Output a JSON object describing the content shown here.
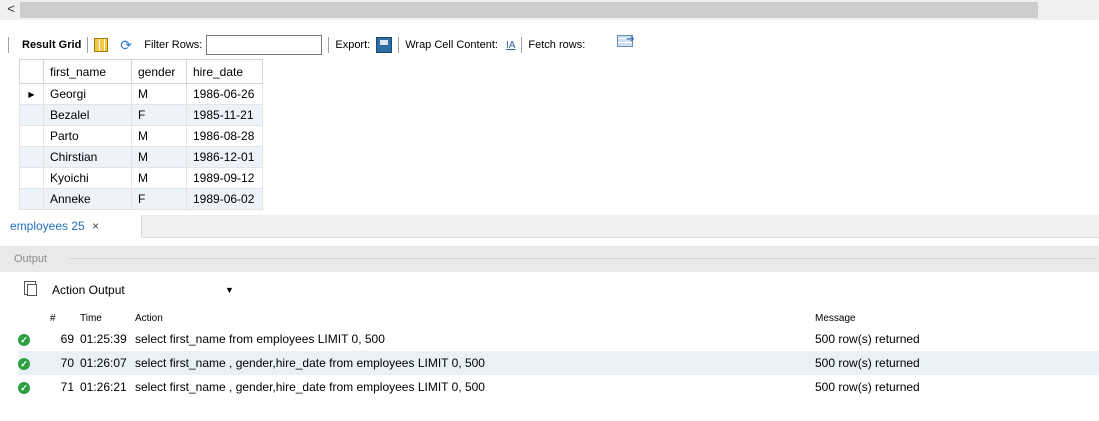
{
  "scroll": {
    "left_arrow": "<"
  },
  "toolbar": {
    "result_grid": "Result Grid",
    "filter_rows": "Filter Rows:",
    "filter_value": "",
    "export": "Export:",
    "wrap_cell": "Wrap Cell Content:",
    "wrap_icon": "IA",
    "fetch_rows": "Fetch rows:"
  },
  "grid": {
    "columns": [
      "first_name",
      "gender",
      "hire_date"
    ],
    "rows": [
      {
        "first_name": "Georgi",
        "gender": "M",
        "hire_date": "1986-06-26"
      },
      {
        "first_name": "Bezalel",
        "gender": "F",
        "hire_date": "1985-11-21"
      },
      {
        "first_name": "Parto",
        "gender": "M",
        "hire_date": "1986-08-28"
      },
      {
        "first_name": "Chirstian",
        "gender": "M",
        "hire_date": "1986-12-01"
      },
      {
        "first_name": "Kyoichi",
        "gender": "M",
        "hire_date": "1989-09-12"
      },
      {
        "first_name": "Anneke",
        "gender": "F",
        "hire_date": "1989-06-02"
      }
    ],
    "current_row_marker": "▶"
  },
  "tab": {
    "label": "employees 25",
    "close": "×"
  },
  "output": {
    "title": "Output",
    "select_value": "Action Output",
    "columns": {
      "num": "#",
      "time": "Time",
      "action": "Action",
      "message": "Message"
    },
    "rows": [
      {
        "num": "69",
        "time": "01:25:39",
        "action": "select first_name from employees LIMIT 0, 500",
        "message": "500 row(s) returned"
      },
      {
        "num": "70",
        "time": "01:26:07",
        "action": "select first_name , gender,hire_date from employees LIMIT 0, 500",
        "message": "500 row(s) returned"
      },
      {
        "num": "71",
        "time": "01:26:21",
        "action": "select first_name , gender,hire_date from employees LIMIT 0, 500",
        "message": "500 row(s) returned"
      }
    ]
  },
  "colors": {
    "success": "#2da041",
    "tab_text": "#1e6fbd",
    "selected_row": "#e9f0f8"
  },
  "icons": [
    "grid-icon",
    "filter-icon",
    "export-icon",
    "wrap-icon",
    "fetch-rows-icon",
    "copy-icon",
    "success-icon",
    "chevron-down-icon",
    "close-icon"
  ]
}
